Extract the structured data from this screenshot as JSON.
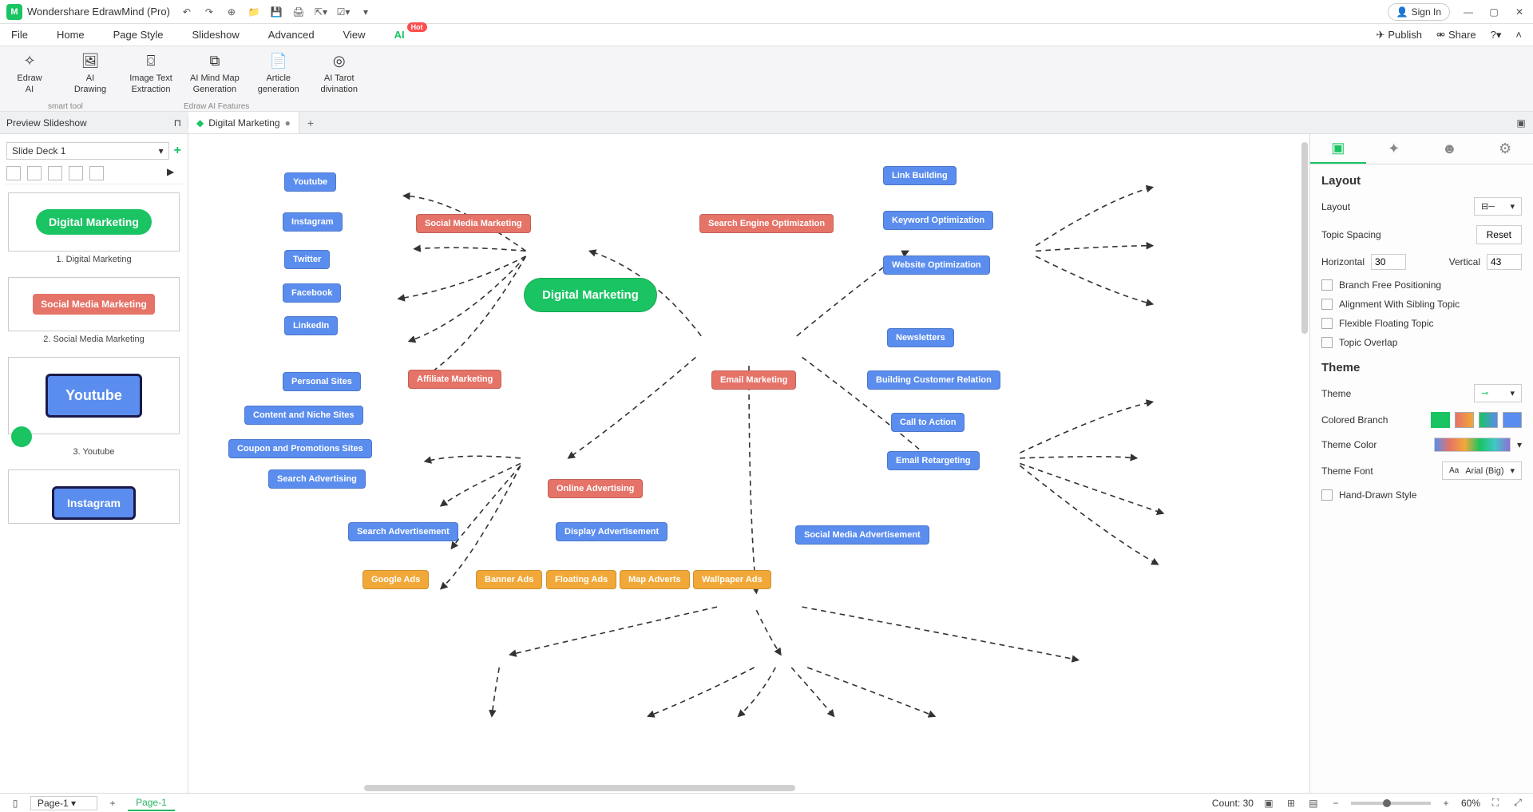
{
  "app": {
    "title": "Wondershare EdrawMind (Pro)"
  },
  "titlebar": {
    "signin": "Sign In"
  },
  "menu": {
    "file": "File",
    "home": "Home",
    "pagestyle": "Page Style",
    "slideshow": "Slideshow",
    "advanced": "Advanced",
    "view": "View",
    "ai": "AI",
    "hot": "Hot",
    "publish": "Publish",
    "share": "Share"
  },
  "ribbon": {
    "edrawai": "Edraw\nAI",
    "aidrawing": "AI\nDrawing",
    "imgtext": "Image Text\nExtraction",
    "aigen": "AI Mind Map\nGeneration",
    "articlegen": "Article\ngeneration",
    "tarot": "AI Tarot\ndivination",
    "grp1": "smart tool",
    "grp2": "Edraw AI Features"
  },
  "docs": {
    "preview": "Preview Slideshow",
    "tabname": "Digital Marketing"
  },
  "deck": {
    "name": "Slide Deck 1"
  },
  "slides": {
    "s1label": "1. Digital Marketing",
    "s1text": "Digital Marketing",
    "s2label": "2. Social Media Marketing",
    "s2text": "Social Media Marketing",
    "s3label": "3. Youtube",
    "s3text": "Youtube",
    "s4text": "Instagram"
  },
  "nodes": {
    "center": "Digital Marketing",
    "smm": "Social Media Marketing",
    "seo": "Search Engine Optimization",
    "aff": "Affiliate Marketing",
    "email": "Email Marketing",
    "online": "Online Advertising",
    "youtube": "Youtube",
    "instagram": "Instagram",
    "twitter": "Twitter",
    "facebook": "Facebook",
    "linkedin": "LinkedIn",
    "link": "Link Building",
    "keyword": "Keyword Optimization",
    "website": "Website Optimization",
    "personal": "Personal Sites",
    "content": "Content and Niche Sites",
    "coupon": "Coupon and Promotions Sites",
    "searchadv": "Search Advertising",
    "newsletters": "Newsletters",
    "relation": "Building Customer Relation",
    "cta": "Call to Action",
    "retarget": "Email Retargeting",
    "searchad": "Search Advertisement",
    "displayad": "Display Advertisement",
    "socialad": "Social Media Advertisement",
    "google": "Google Ads",
    "banner": "Banner Ads",
    "floating": "Floating Ads",
    "mapad": "Map Adverts",
    "wallpaper": "Wallpaper Ads"
  },
  "panel": {
    "layout_h": "Layout",
    "layout_lbl": "Layout",
    "spacing": "Topic Spacing",
    "reset": "Reset",
    "horiz": "Horizontal",
    "hval": "30",
    "vert": "Vertical",
    "vval": "43",
    "cb1": "Branch Free Positioning",
    "cb2": "Alignment With Sibling Topic",
    "cb3": "Flexible Floating Topic",
    "cb4": "Topic Overlap",
    "theme_h": "Theme",
    "theme_lbl": "Theme",
    "colored": "Colored Branch",
    "themecolor": "Theme Color",
    "themefont": "Theme Font",
    "fontval": "Arial (Big)",
    "handdrawn": "Hand-Drawn Style"
  },
  "status": {
    "page": "Page-1",
    "pageactive": "Page-1",
    "count": "Count: 30",
    "zoom": "60%"
  }
}
